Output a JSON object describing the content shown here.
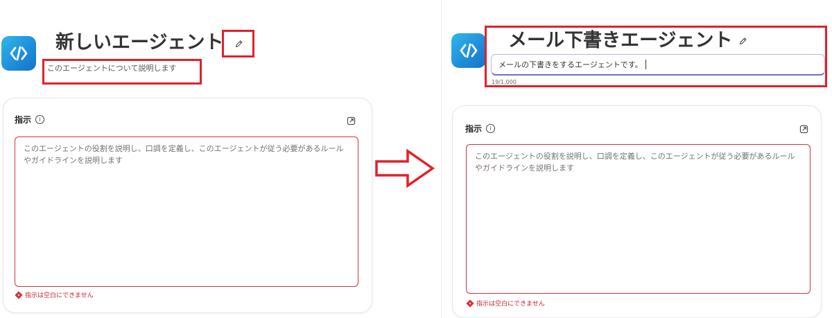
{
  "before": {
    "title": "新しいエージェント",
    "description_placeholder": "このエージェントについて説明します",
    "instructions": {
      "label": "指示",
      "info_icon": "info-icon",
      "expand_icon": "open-in-new-icon",
      "placeholder": "このエージェントの役割を説明し、口調を定義し、このエージェントが従う必要があるルールやガイドラインを説明します",
      "error": "指示は空白にできません"
    }
  },
  "after": {
    "title": "メール下書きエージェント",
    "description_value": "メールの下書きをするエージェントです。",
    "counter": "19/1,000",
    "instructions": {
      "label": "指示",
      "info_icon": "info-icon",
      "expand_icon": "open-in-new-icon",
      "placeholder": "このエージェントの役割を説明し、口調を定義し、このエージェントが従う必要があるルールやガイドラインを説明します",
      "error": "指示は空白にできません"
    }
  },
  "colors": {
    "highlight": "#e2202b",
    "error": "#d13438",
    "logo_gradient": [
      "#2fb8ea",
      "#1573c8"
    ],
    "input_focus": "#6a6fcf"
  },
  "icons": {
    "logo": "code-brackets-logo",
    "edit": "pencil-icon",
    "arrow": "right-arrow"
  }
}
